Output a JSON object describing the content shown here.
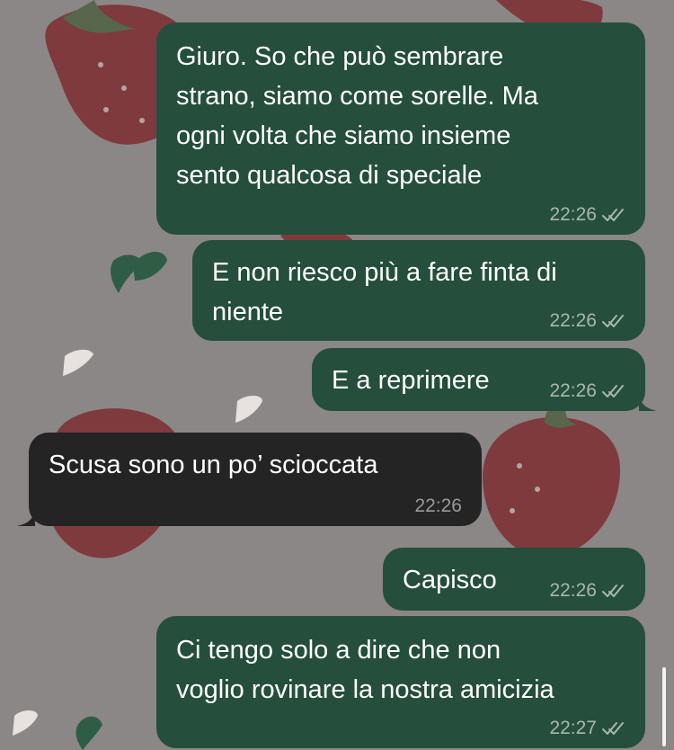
{
  "colors": {
    "background": "#8b8786",
    "outgoing_bubble": "#254e3c",
    "incoming_bubble": "#242424",
    "text": "#ffffff",
    "timestamp": "#a9b7b0"
  },
  "messages": [
    {
      "direction": "outgoing",
      "lines": [
        "Giuro. So che può sembrare",
        "strano, siamo come sorelle. Ma",
        "ogni volta che siamo insieme",
        "sento qualcosa di speciale"
      ],
      "time": "22:26",
      "status_icon": "double-check-icon"
    },
    {
      "direction": "outgoing",
      "lines": [
        "E non riesco più a fare finta di",
        "niente"
      ],
      "time": "22:26",
      "status_icon": "double-check-icon"
    },
    {
      "direction": "outgoing",
      "lines": [
        "E a reprimere"
      ],
      "time": "22:26",
      "status_icon": "double-check-icon"
    },
    {
      "direction": "incoming",
      "lines": [
        "Scusa sono un po’ scioccata"
      ],
      "time": "22:26"
    },
    {
      "direction": "outgoing",
      "lines": [
        "Capisco"
      ],
      "time": "22:26",
      "status_icon": "double-check-icon"
    },
    {
      "direction": "outgoing",
      "lines": [
        "Ci tengo solo a dire che non",
        "voglio rovinare la nostra amicizia"
      ],
      "time": "22:27",
      "status_icon": "double-check-icon"
    }
  ]
}
